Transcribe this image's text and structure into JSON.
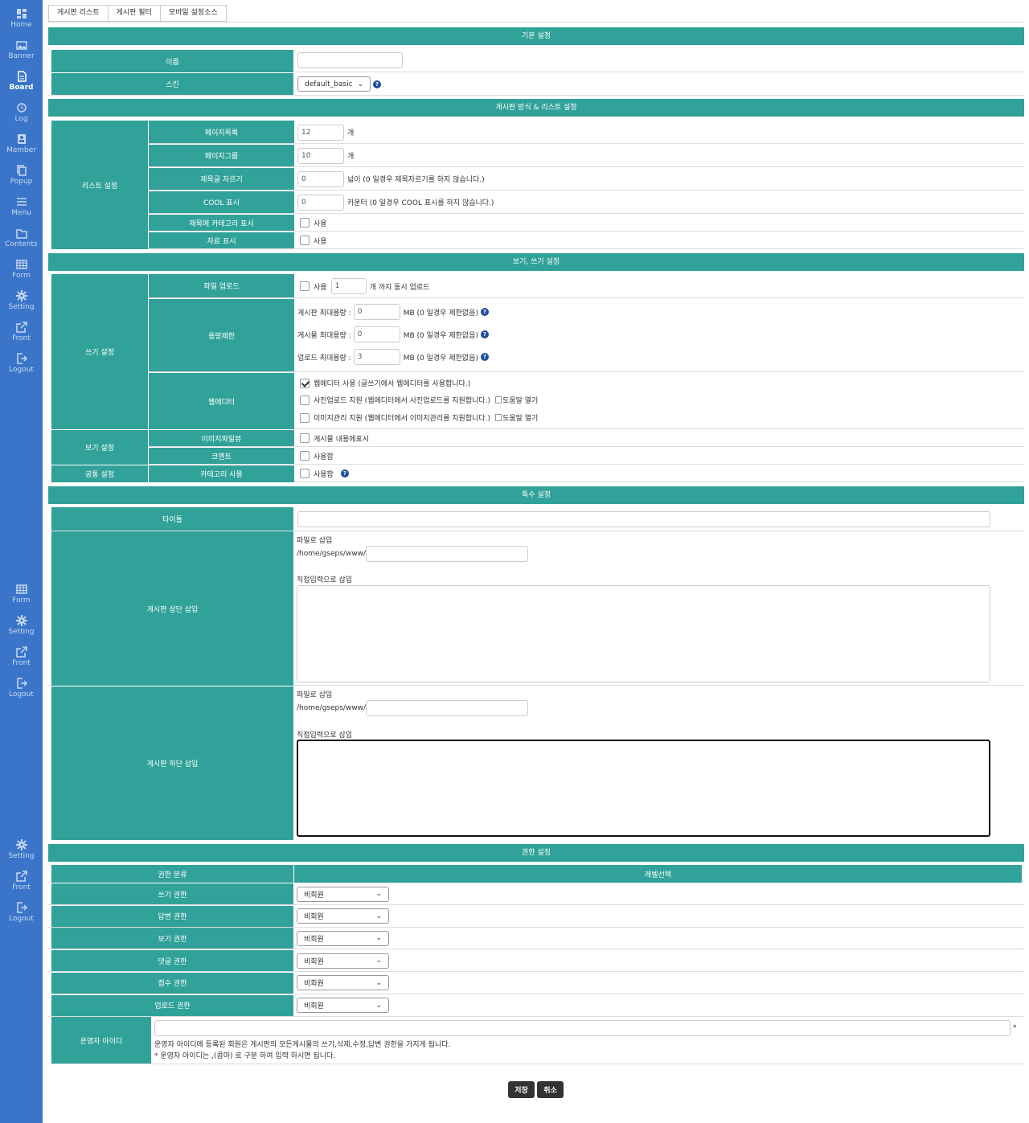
{
  "sidebar": {
    "items": [
      {
        "label": "Home",
        "icon": "dashboard-icon"
      },
      {
        "label": "Banner",
        "icon": "image-icon"
      },
      {
        "label": "Board",
        "icon": "document-icon"
      },
      {
        "label": "Log",
        "icon": "history-icon"
      },
      {
        "label": "Member",
        "icon": "user-card-icon"
      },
      {
        "label": "Popup",
        "icon": "copy-icon"
      },
      {
        "label": "Menu",
        "icon": "list-icon"
      },
      {
        "label": "Contents",
        "icon": "folder-icon"
      },
      {
        "label": "Form",
        "icon": "table-icon"
      },
      {
        "label": "Setting",
        "icon": "gear-icon"
      },
      {
        "label": "Front",
        "icon": "external-link-icon"
      },
      {
        "label": "Logout",
        "icon": "logout-icon"
      },
      {
        "label": "Form",
        "icon": "table-icon"
      },
      {
        "label": "Setting",
        "icon": "gear-icon"
      },
      {
        "label": "Front",
        "icon": "external-link-icon"
      },
      {
        "label": "Logout",
        "icon": "logout-icon"
      },
      {
        "label": "Setting",
        "icon": "gear-icon"
      },
      {
        "label": "Front",
        "icon": "external-link-icon"
      },
      {
        "label": "Logout",
        "icon": "logout-icon"
      }
    ]
  },
  "tabs": [
    "게시판 리스트",
    "게시판 필터",
    "모바일 설정소스"
  ],
  "basic": {
    "title": "기본 설정",
    "name_label": "이름",
    "name_value": "",
    "skin_label": "스킨",
    "skin_value": "default_basic"
  },
  "list": {
    "title": "게시판 방식 & 리스트 설정",
    "group_label": "리스트 설정",
    "page_count_label": "페이지목록",
    "page_count_value": "12",
    "page_count_unit": "개",
    "page_group_label": "페이지그룹",
    "page_group_value": "10",
    "page_group_unit": "개",
    "title_cut_label": "제목글 자르기",
    "title_cut_value": "0",
    "title_cut_desc": "넓이 (0 일경우 제목자르기를 하지 않습니다.)",
    "cool_label": "COOL 표시",
    "cool_value": "0",
    "cool_desc": "카운터 (0 일경우 COOL 표시를 하지 않습니다.)",
    "category_label": "제목에 카테고리 표시",
    "category_desc": "사용",
    "data_label": "자료 표시",
    "data_desc": "사용"
  },
  "view": {
    "title": "보기, 쓰기 설정",
    "write_group": "쓰기 설정",
    "upload_label": "파일 업로드",
    "upload_use": "사용",
    "upload_value": "1",
    "upload_desc": "개 까지 동시 업로드",
    "capacity_label": "용량제한",
    "board_max_label": "게시판 최대용량 :",
    "board_max_value": "0",
    "board_max_desc": "MB (0 일경우 제한없음)",
    "post_max_label": "게시물 최대용량 :",
    "post_max_value": "0",
    "post_max_desc": "MB (0 일경우 제한없음)",
    "upload_max_label": "업로드 최대용량 :",
    "upload_max_value": "3",
    "upload_max_desc": "MB (0 일경우 제한없음)",
    "editor_label": "웹에디터",
    "editor_use": "웹에디터 사용 (글쓰기에서 웹에디터를 사용합니다.)",
    "photo_upload": "사진업로드 지원 (웹에디터에서 사진업로드를 지원합니다.)",
    "image_manage": "이미지관리 지원 (웹에디터에서 이미지관리를 지원합니다.)",
    "help_open": "도움말 열기",
    "view_group": "보기 설정",
    "image_view_label": "이미지파일뷰",
    "image_view_desc": "게시물 내용에표시",
    "comment_label": "코멘트",
    "comment_desc": "사용함",
    "common_group": "공통 설정",
    "cat_use_label": "카테고리 사용",
    "cat_use_desc": "사용함"
  },
  "special": {
    "title": "특수 설정",
    "title_label": "타이틀",
    "title_value": "",
    "top_label": "게시판 상단 삽입",
    "bottom_label": "게시판 하단 삽입",
    "file_insert": "파일로 삽입",
    "path_prefix": "/home/gseps/www/",
    "direct_insert": "직접입력으로 삽입"
  },
  "perm": {
    "title": "권한 설정",
    "col_category": "권한 분류",
    "col_level": "레벨선택",
    "rows": [
      {
        "label": "쓰기 권한",
        "value": "비회원"
      },
      {
        "label": "답변 권한",
        "value": "비회원"
      },
      {
        "label": "보기 권한",
        "value": "비회원"
      },
      {
        "label": "댓글 권한",
        "value": "비회원"
      },
      {
        "label": "점수 권한",
        "value": "비회원"
      },
      {
        "label": "업로드 권한",
        "value": "비회원"
      }
    ],
    "admin_label": "운영자 아이디",
    "admin_value": "",
    "admin_star": "*",
    "admin_note1": "운영자 아이디에 등록된 회원은 게시판의 모든게시물의 쓰기,삭제,수정,답변 권한을 가지게 됩니다.",
    "admin_note2": "* 운영자 아이디는 ,(콤마) 로 구분 하여 입력 하시면 됩니다."
  },
  "buttons": {
    "save": "저장",
    "cancel": "취소"
  },
  "colors": {
    "sidebar": "#3a75c9",
    "accent": "#31a299",
    "button": "#333333"
  }
}
